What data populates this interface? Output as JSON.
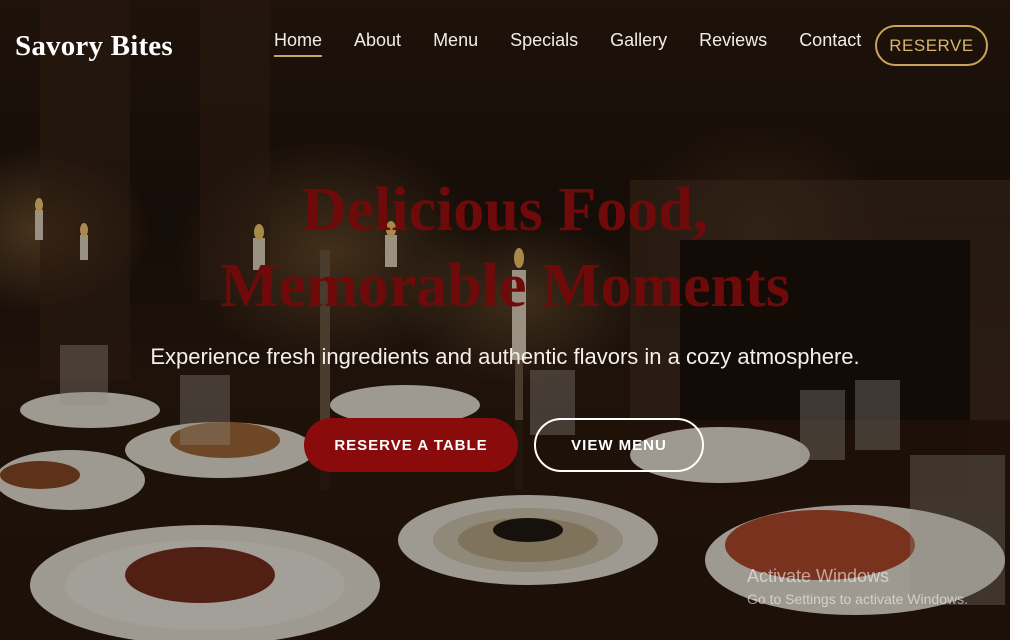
{
  "brand": {
    "name": "Savory Bites"
  },
  "nav": {
    "items": [
      {
        "label": "Home",
        "active": true
      },
      {
        "label": "About"
      },
      {
        "label": "Menu"
      },
      {
        "label": "Specials"
      },
      {
        "label": "Gallery"
      },
      {
        "label": "Reviews"
      },
      {
        "label": "Contact"
      }
    ],
    "reserve_label": "RESERVE"
  },
  "hero": {
    "title_line1": "Delicious Food,",
    "title_line2": "Memorable Moments",
    "subtitle": "Experience fresh ingredients and authentic flavors in a cozy atmosphere.",
    "primary_cta": "RESERVE A TABLE",
    "secondary_cta": "VIEW MENU"
  },
  "watermark": {
    "title": "Activate Windows",
    "subtitle": "Go to Settings to activate Windows."
  },
  "colors": {
    "accent_gold": "#c9a45a",
    "brand_red": "#8a0b0b",
    "title_red": "#6e0a0a"
  }
}
